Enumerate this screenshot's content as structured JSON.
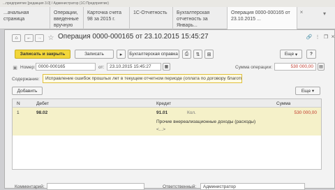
{
  "window_title": "...предприятие [редакция 3.0] / Администратор (1С:Предприятие)",
  "tabs": [
    {
      "label": "...ачальная страница"
    },
    {
      "label": "Операции, введенные вручную"
    },
    {
      "label": "Карточка счета 98 за 2015 г."
    },
    {
      "label": "1С-Отчетность"
    },
    {
      "label": "Бухгалтерская отчетность за Январь..."
    },
    {
      "label": "Операция 0000-000165 от 23.10.2015 ..."
    }
  ],
  "document": {
    "title": "Операция 0000-000165 от 23.10.2015 15:45:27",
    "toolbar": {
      "post_close": "Записать и закрыть",
      "save": "Записать",
      "reference": "Бухгалтерская справка",
      "more": "Еще",
      "help": "?"
    },
    "header": {
      "number_label": "Номер:",
      "number_value": "0000-000165",
      "date_label": "от:",
      "date_value": "23.10.2015 15:45:27",
      "amount_label": "Сумма операции:",
      "amount_value": "530 000,00"
    },
    "content_label": "Содержание:",
    "content_value": "Исправление ошибок прошлых лет в текущем отчетном периоде (оплата по договору благотвор",
    "add_button": "Добавить",
    "table_more": "Еще",
    "table": {
      "headers": {
        "n": "N",
        "debit": "Дебет",
        "credit": "Кредит",
        "amount": "Сумма"
      },
      "rows": [
        {
          "n": "1",
          "debit": "98.02",
          "credit": "91.01",
          "qty_label": "Кол.",
          "subconto": "Прочие внереализационные доходы (расходы)",
          "subconto2": "<...>",
          "amount": "530 000,00"
        }
      ]
    },
    "footer": {
      "comment_label": "Комментарий:",
      "responsible_label": "Ответственный:",
      "responsible_value": "Администратор"
    }
  },
  "colors": {
    "accent": "#f2d63a",
    "amount": "#c0392b",
    "selected_row": "#f5f1c9"
  }
}
